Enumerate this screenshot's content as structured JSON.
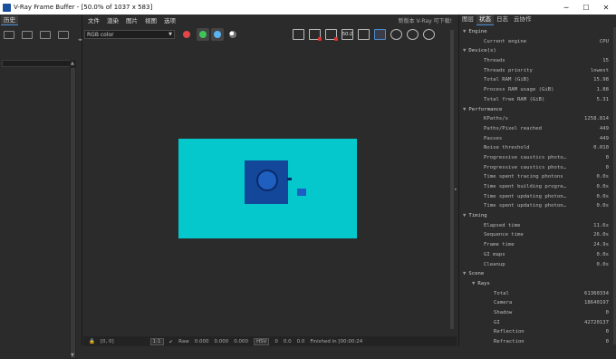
{
  "window": {
    "title": "V-Ray Frame Buffer - [50.0% of 1037 x 583]",
    "minimize": "─",
    "maximize": "☐",
    "close": "✕"
  },
  "left_panel": {
    "tab": "历史",
    "search_placeholder": ""
  },
  "menu": {
    "items": [
      "文件",
      "渲染",
      "图片",
      "视图",
      "选项"
    ],
    "version_notice": "新版本 V-Ray 可下载!"
  },
  "toolbar": {
    "channel": "RGB color",
    "colors": {
      "red": "#e34646",
      "green": "#3fc45a",
      "blue": "#5ab4f0"
    },
    "zoom_badge": "50:2"
  },
  "render": {
    "bg_color": "#04c8cc",
    "object_color": "#13479a"
  },
  "statusbar": {
    "coords": "[0, 0]",
    "ratio": "1:1",
    "mode": "Raw",
    "r": "0.000",
    "g": "0.000",
    "b": "0.000",
    "colorspace": "HSV",
    "h": "0",
    "s": "0.0",
    "v": "0.0",
    "status": "Finished in [00:00:24"
  },
  "right_panel": {
    "tabs": [
      "图层",
      "状态",
      "日志",
      "云协作"
    ],
    "active_tab": 1,
    "stats": [
      {
        "type": "section",
        "label": "Engine"
      },
      {
        "type": "row",
        "key": "Current engine",
        "value": "CPU"
      },
      {
        "type": "section",
        "label": "Device(s)"
      },
      {
        "type": "row",
        "key": "Threads",
        "value": "15"
      },
      {
        "type": "row",
        "key": "Threads priority",
        "value": "lowest"
      },
      {
        "type": "row",
        "key": "Total RAM (GiB)",
        "value": "15.98"
      },
      {
        "type": "row",
        "key": "Process RAM usage (GiB)",
        "value": "1.88"
      },
      {
        "type": "row",
        "key": "Total free RAM (GiB)",
        "value": "5.31"
      },
      {
        "type": "section",
        "label": "Performance"
      },
      {
        "type": "row",
        "key": "KPaths/s",
        "value": "1258.814"
      },
      {
        "type": "row",
        "key": "Paths/Pixel reached",
        "value": "449"
      },
      {
        "type": "row",
        "key": "Passes",
        "value": "449"
      },
      {
        "type": "row",
        "key": "Noise threshold",
        "value": "0.010"
      },
      {
        "type": "row",
        "key": "Progressive caustics photo…",
        "value": "0"
      },
      {
        "type": "row",
        "key": "Progressive caustics photo…",
        "value": "0"
      },
      {
        "type": "row",
        "key": "Time spent tracing photons",
        "value": "0.0s"
      },
      {
        "type": "row",
        "key": "Time spent building progre…",
        "value": "0.0s"
      },
      {
        "type": "row",
        "key": "Time spent updating photon…",
        "value": "0.0s"
      },
      {
        "type": "row",
        "key": "Time spent updating photon…",
        "value": "0.0s"
      },
      {
        "type": "section",
        "label": "Timing"
      },
      {
        "type": "row",
        "key": "Elapsed time",
        "value": "11.6s"
      },
      {
        "type": "row",
        "key": "Sequence time",
        "value": "26.0s"
      },
      {
        "type": "row",
        "key": "Frame time",
        "value": "24.9s"
      },
      {
        "type": "row",
        "key": "GI maps",
        "value": "0.0s"
      },
      {
        "type": "row",
        "key": "Cleanup",
        "value": "0.0s"
      },
      {
        "type": "section",
        "label": "Scene"
      },
      {
        "type": "sub",
        "key": "Rays"
      },
      {
        "type": "row2",
        "key": "Total",
        "value": "61360334"
      },
      {
        "type": "row2",
        "key": "Camera",
        "value": "18640197"
      },
      {
        "type": "row2",
        "key": "Shadow",
        "value": "0"
      },
      {
        "type": "row2",
        "key": "GI",
        "value": "42720137"
      },
      {
        "type": "row2",
        "key": "Reflection",
        "value": "0"
      },
      {
        "type": "row2",
        "key": "Refraction",
        "value": "0"
      }
    ]
  }
}
